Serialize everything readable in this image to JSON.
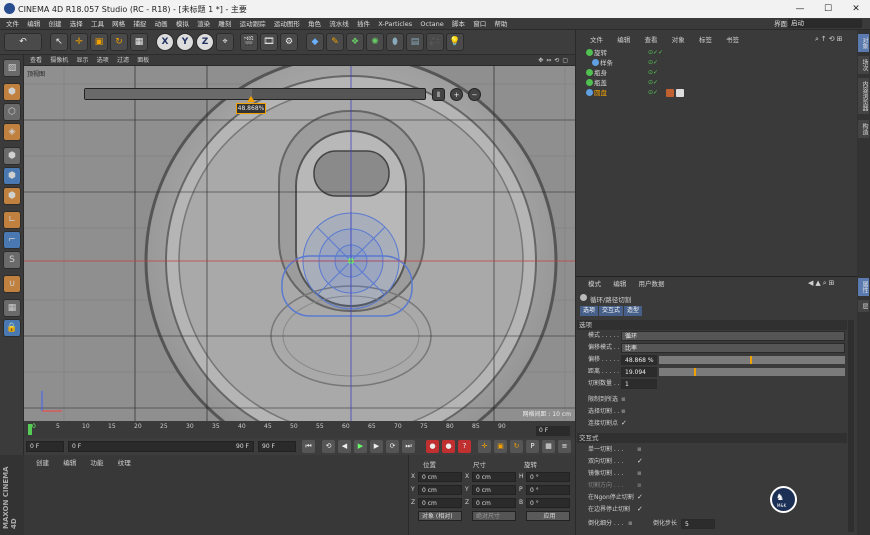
{
  "title": "CINEMA 4D R18.057 Studio (RC - R18) - [未标题 1 *] - 主要",
  "window_controls": [
    "—",
    "☐",
    "✕"
  ],
  "menu": [
    "文件",
    "编辑",
    "创建",
    "选择",
    "工具",
    "网格",
    "捕捉",
    "动画",
    "模拟",
    "渲染",
    "雕刻",
    "运动跟踪",
    "运动图形",
    "角色",
    "流水线",
    "插件",
    "X-Particles",
    "Octane",
    "脚本",
    "窗口",
    "帮助"
  ],
  "layout": {
    "label": "界面:",
    "value": "启动"
  },
  "toolbar": {
    "x": "X",
    "y": "Y",
    "z": "Z"
  },
  "viewport": {
    "menu": [
      "查看",
      "摄像机",
      "显示",
      "选项",
      "过滤",
      "面板"
    ],
    "label": "顶视图",
    "slider_value": "48.868%",
    "slider_fraction": 0.49,
    "scale_text": "网格间距 : 10 cm",
    "grid_color": "#222222"
  },
  "timeline": {
    "ticks": [
      "0",
      "5",
      "10",
      "15",
      "20",
      "25",
      "30",
      "35",
      "40",
      "45",
      "50",
      "55",
      "60",
      "65",
      "70",
      "75",
      "80",
      "85",
      "90"
    ],
    "frame": "0 F",
    "start": "0 F",
    "range_start": "0 F",
    "range_end": "90 F",
    "end": "90 F"
  },
  "material_menu": [
    "创建",
    "编辑",
    "功能",
    "纹理"
  ],
  "coords": {
    "headers": [
      "位置",
      "尺寸",
      "旋转"
    ],
    "rows": [
      {
        "axis": "X",
        "pos": "0 cm",
        "sizeaxis": "X",
        "size": "0 cm",
        "rotaxis": "H",
        "rot": "0 °"
      },
      {
        "axis": "Y",
        "pos": "0 cm",
        "sizeaxis": "Y",
        "size": "0 cm",
        "rotaxis": "P",
        "rot": "0 °"
      },
      {
        "axis": "Z",
        "pos": "0 cm",
        "sizeaxis": "Z",
        "size": "0 cm",
        "rotaxis": "B",
        "rot": "0 °"
      }
    ],
    "mode": "对象 (相对)",
    "size_mode": "绝对尺寸",
    "apply": "应用"
  },
  "objects": {
    "menu": [
      "文件",
      "编辑",
      "查看",
      "对象",
      "标签",
      "书签"
    ],
    "items": [
      {
        "name": "旋转",
        "indent": 0,
        "color": "#50c050"
      },
      {
        "name": "样条",
        "indent": 1,
        "color": "#60a0e0"
      },
      {
        "name": "瓶身",
        "indent": 0,
        "color": "#50c050"
      },
      {
        "name": "瓶盖",
        "indent": 0,
        "color": "#50c050"
      },
      {
        "name": "圆盘",
        "indent": 0,
        "color": "#60a0e0",
        "selected": true
      }
    ]
  },
  "right_tabs": [
    "对象",
    "场次",
    "内容浏览器",
    "构造"
  ],
  "right_tabs2": [
    "属性",
    "层"
  ],
  "attributes": {
    "menu": [
      "模式",
      "编辑",
      "用户数据"
    ],
    "tool": "循环/路径切割",
    "tabs": [
      "选项",
      "交互式",
      "造型"
    ],
    "section1": "选项",
    "mode_label": "模式 . . . . . .",
    "mode_value": "循环",
    "offset_mode_label": "偏移模式 . . .",
    "offset_mode_value": "比率",
    "offset_label": "偏移 . . . . . .",
    "offset_value": "48.868 %",
    "offset_fraction": 0.49,
    "distance_label": "距离 . . . . . .",
    "distance_value": "19.094 cm",
    "distance_fraction": 0.19,
    "cuts_label": "切割数量 . . .",
    "cuts_value": "1",
    "limit_label": "限制到所选",
    "select_cut_label": "选择切割 . . .",
    "connect_label": "连接切割点",
    "section2": "交互式",
    "single_label": "单一切割 . . .",
    "bidirectional_label": "双向切割 . . .",
    "mirror_label": "镜像切割 . . .",
    "cut_dir_label": "切割方向 . . .",
    "ngon_label": "在Ngon停止切割",
    "edge_label": "在边界停止切割",
    "bevel_label": "倒化细分 . . .",
    "bevel_steps_label": "倒化步长",
    "bevel_steps_value": "5"
  },
  "maxon": "MAXON CINEMA 4D",
  "avatar_text": "M&K"
}
